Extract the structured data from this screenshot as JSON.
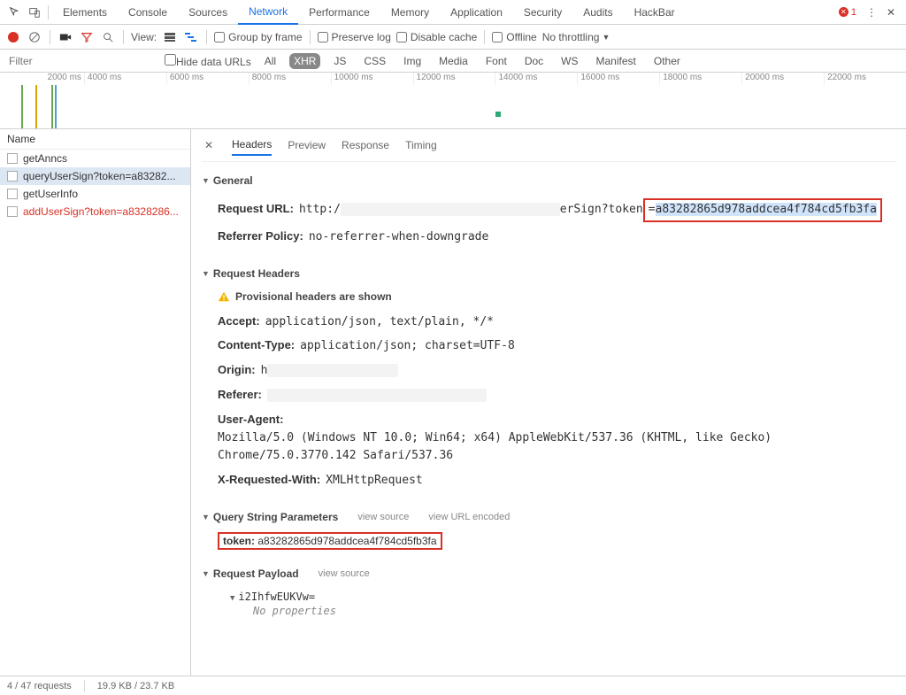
{
  "topTabs": {
    "items": [
      "Elements",
      "Console",
      "Sources",
      "Network",
      "Performance",
      "Memory",
      "Application",
      "Security",
      "Audits",
      "HackBar"
    ],
    "active": "Network",
    "errorCount": "1"
  },
  "toolbar": {
    "viewLabel": "View:",
    "groupByFrame": "Group by frame",
    "preserveLog": "Preserve log",
    "disableCache": "Disable cache",
    "offline": "Offline",
    "throttling": "No throttling"
  },
  "filterRow": {
    "placeholder": "Filter",
    "hideData": "Hide data URLs",
    "types": [
      "All",
      "XHR",
      "JS",
      "CSS",
      "Img",
      "Media",
      "Font",
      "Doc",
      "WS",
      "Manifest",
      "Other"
    ],
    "selected": "XHR"
  },
  "timeline": {
    "ticks": [
      "2000 ms",
      "4000 ms",
      "6000 ms",
      "8000 ms",
      "10000 ms",
      "12000 ms",
      "14000 ms",
      "16000 ms",
      "18000 ms",
      "20000 ms",
      "22000 ms"
    ]
  },
  "sidebar": {
    "header": "Name",
    "items": [
      {
        "label": "getAnncs"
      },
      {
        "label": "queryUserSign?token=a83282...",
        "selected": true
      },
      {
        "label": "getUserInfo"
      },
      {
        "label": "addUserSign?token=a8328286...",
        "red": true
      }
    ]
  },
  "detailTabs": {
    "items": [
      "Headers",
      "Preview",
      "Response",
      "Timing"
    ],
    "active": "Headers"
  },
  "general": {
    "title": "General",
    "requestUrlLabel": "Request URL:",
    "urlPrefix": "http:/",
    "urlMid": "erSign?token",
    "urlEq": "=",
    "urlToken": "a83282865d978addcea4f784cd5fb3fa",
    "referrerPolicyLabel": "Referrer Policy:",
    "referrerPolicy": "no-referrer-when-downgrade"
  },
  "reqHeaders": {
    "title": "Request Headers",
    "provisional": "Provisional headers are shown",
    "acceptLabel": "Accept:",
    "accept": "application/json, text/plain, */*",
    "contentTypeLabel": "Content-Type:",
    "contentType": "application/json; charset=UTF-8",
    "originLabel": "Origin:",
    "origin": "h",
    "refererLabel": "Referer:",
    "referer": "",
    "uaLabel": "User-Agent:",
    "ua": "Mozilla/5.0 (Windows NT 10.0; Win64; x64) AppleWebKit/537.36 (KHTML, like Gecko) Chrome/75.0.3770.142 Safari/537.36",
    "xreqLabel": "X-Requested-With:",
    "xreq": "XMLHttpRequest"
  },
  "queryParams": {
    "title": "Query String Parameters",
    "viewSource": "view source",
    "viewEncoded": "view URL encoded",
    "tokenLabel": "token:",
    "token": "a83282865d978addcea4f784cd5fb3fa"
  },
  "payload": {
    "title": "Request Payload",
    "viewSource": "view source",
    "body": "i2IhfwEUKVw=",
    "noProps": "No properties"
  },
  "status": {
    "requests": "4 / 47 requests",
    "size": "19.9 KB / 23.7 KB"
  }
}
